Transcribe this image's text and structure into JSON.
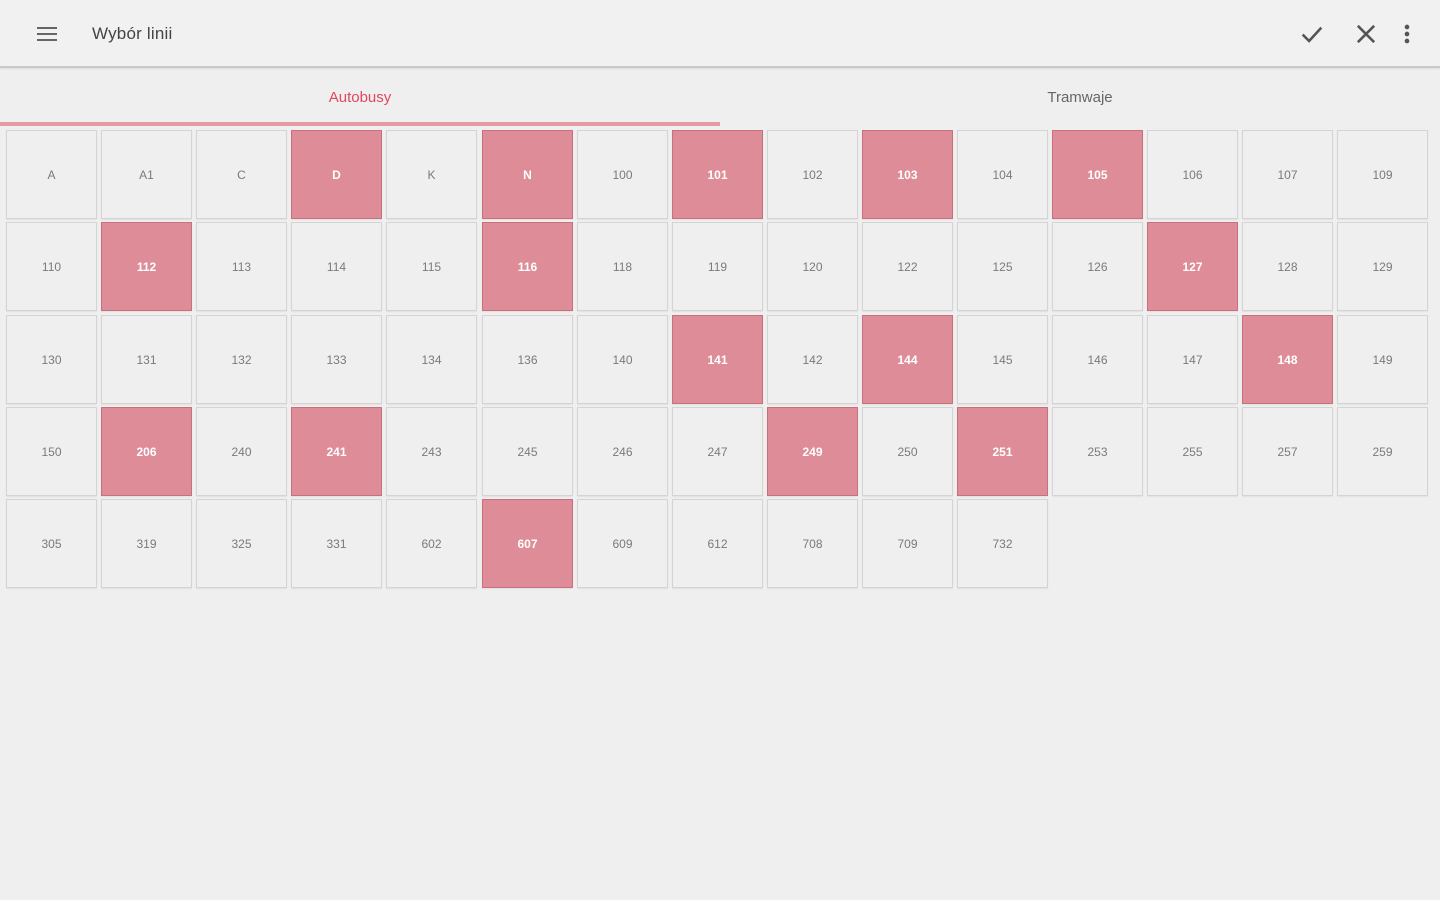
{
  "appbar": {
    "title": "Wybór linii",
    "icons": [
      "menu-icon",
      "check-icon",
      "close-icon",
      "more-vert-icon"
    ]
  },
  "tabs": [
    {
      "label": "Autobusy",
      "active": true
    },
    {
      "label": "Tramwaje",
      "active": false
    }
  ],
  "colors": {
    "accent": "#e0485f",
    "selected_cell": "#de8d98",
    "indicator": "#e69aa6",
    "background": "#efefef"
  },
  "lines": [
    {
      "label": "A",
      "selected": false
    },
    {
      "label": "A1",
      "selected": false
    },
    {
      "label": "C",
      "selected": false
    },
    {
      "label": "D",
      "selected": true
    },
    {
      "label": "K",
      "selected": false
    },
    {
      "label": "N",
      "selected": true
    },
    {
      "label": "100",
      "selected": false
    },
    {
      "label": "101",
      "selected": true
    },
    {
      "label": "102",
      "selected": false
    },
    {
      "label": "103",
      "selected": true
    },
    {
      "label": "104",
      "selected": false
    },
    {
      "label": "105",
      "selected": true
    },
    {
      "label": "106",
      "selected": false
    },
    {
      "label": "107",
      "selected": false
    },
    {
      "label": "109",
      "selected": false
    },
    {
      "label": "110",
      "selected": false
    },
    {
      "label": "112",
      "selected": true
    },
    {
      "label": "113",
      "selected": false
    },
    {
      "label": "114",
      "selected": false
    },
    {
      "label": "115",
      "selected": false
    },
    {
      "label": "116",
      "selected": true
    },
    {
      "label": "118",
      "selected": false
    },
    {
      "label": "119",
      "selected": false
    },
    {
      "label": "120",
      "selected": false
    },
    {
      "label": "122",
      "selected": false
    },
    {
      "label": "125",
      "selected": false
    },
    {
      "label": "126",
      "selected": false
    },
    {
      "label": "127",
      "selected": true
    },
    {
      "label": "128",
      "selected": false
    },
    {
      "label": "129",
      "selected": false
    },
    {
      "label": "130",
      "selected": false
    },
    {
      "label": "131",
      "selected": false
    },
    {
      "label": "132",
      "selected": false
    },
    {
      "label": "133",
      "selected": false
    },
    {
      "label": "134",
      "selected": false
    },
    {
      "label": "136",
      "selected": false
    },
    {
      "label": "140",
      "selected": false
    },
    {
      "label": "141",
      "selected": true
    },
    {
      "label": "142",
      "selected": false
    },
    {
      "label": "144",
      "selected": true
    },
    {
      "label": "145",
      "selected": false
    },
    {
      "label": "146",
      "selected": false
    },
    {
      "label": "147",
      "selected": false
    },
    {
      "label": "148",
      "selected": true
    },
    {
      "label": "149",
      "selected": false
    },
    {
      "label": "150",
      "selected": false
    },
    {
      "label": "206",
      "selected": true
    },
    {
      "label": "240",
      "selected": false
    },
    {
      "label": "241",
      "selected": true
    },
    {
      "label": "243",
      "selected": false
    },
    {
      "label": "245",
      "selected": false
    },
    {
      "label": "246",
      "selected": false
    },
    {
      "label": "247",
      "selected": false
    },
    {
      "label": "249",
      "selected": true
    },
    {
      "label": "250",
      "selected": false
    },
    {
      "label": "251",
      "selected": true
    },
    {
      "label": "253",
      "selected": false
    },
    {
      "label": "255",
      "selected": false
    },
    {
      "label": "257",
      "selected": false
    },
    {
      "label": "259",
      "selected": false
    },
    {
      "label": "305",
      "selected": false
    },
    {
      "label": "319",
      "selected": false
    },
    {
      "label": "325",
      "selected": false
    },
    {
      "label": "331",
      "selected": false
    },
    {
      "label": "602",
      "selected": false
    },
    {
      "label": "607",
      "selected": true
    },
    {
      "label": "609",
      "selected": false
    },
    {
      "label": "612",
      "selected": false
    },
    {
      "label": "708",
      "selected": false
    },
    {
      "label": "709",
      "selected": false
    },
    {
      "label": "732",
      "selected": false
    }
  ]
}
